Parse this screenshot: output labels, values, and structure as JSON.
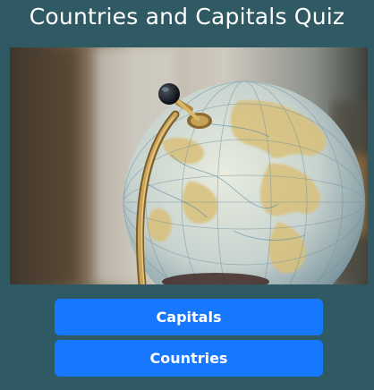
{
  "page": {
    "title": "Countries and Capitals Quiz"
  },
  "hero_image": {
    "subject": "globe-photo"
  },
  "buttons": {
    "capitals_label": "Capitals",
    "countries_label": "Countries"
  },
  "colors": {
    "background": "#2f5a63",
    "button": "#1677ff",
    "button_text": "#ffffff",
    "title_text": "#ffffff"
  }
}
